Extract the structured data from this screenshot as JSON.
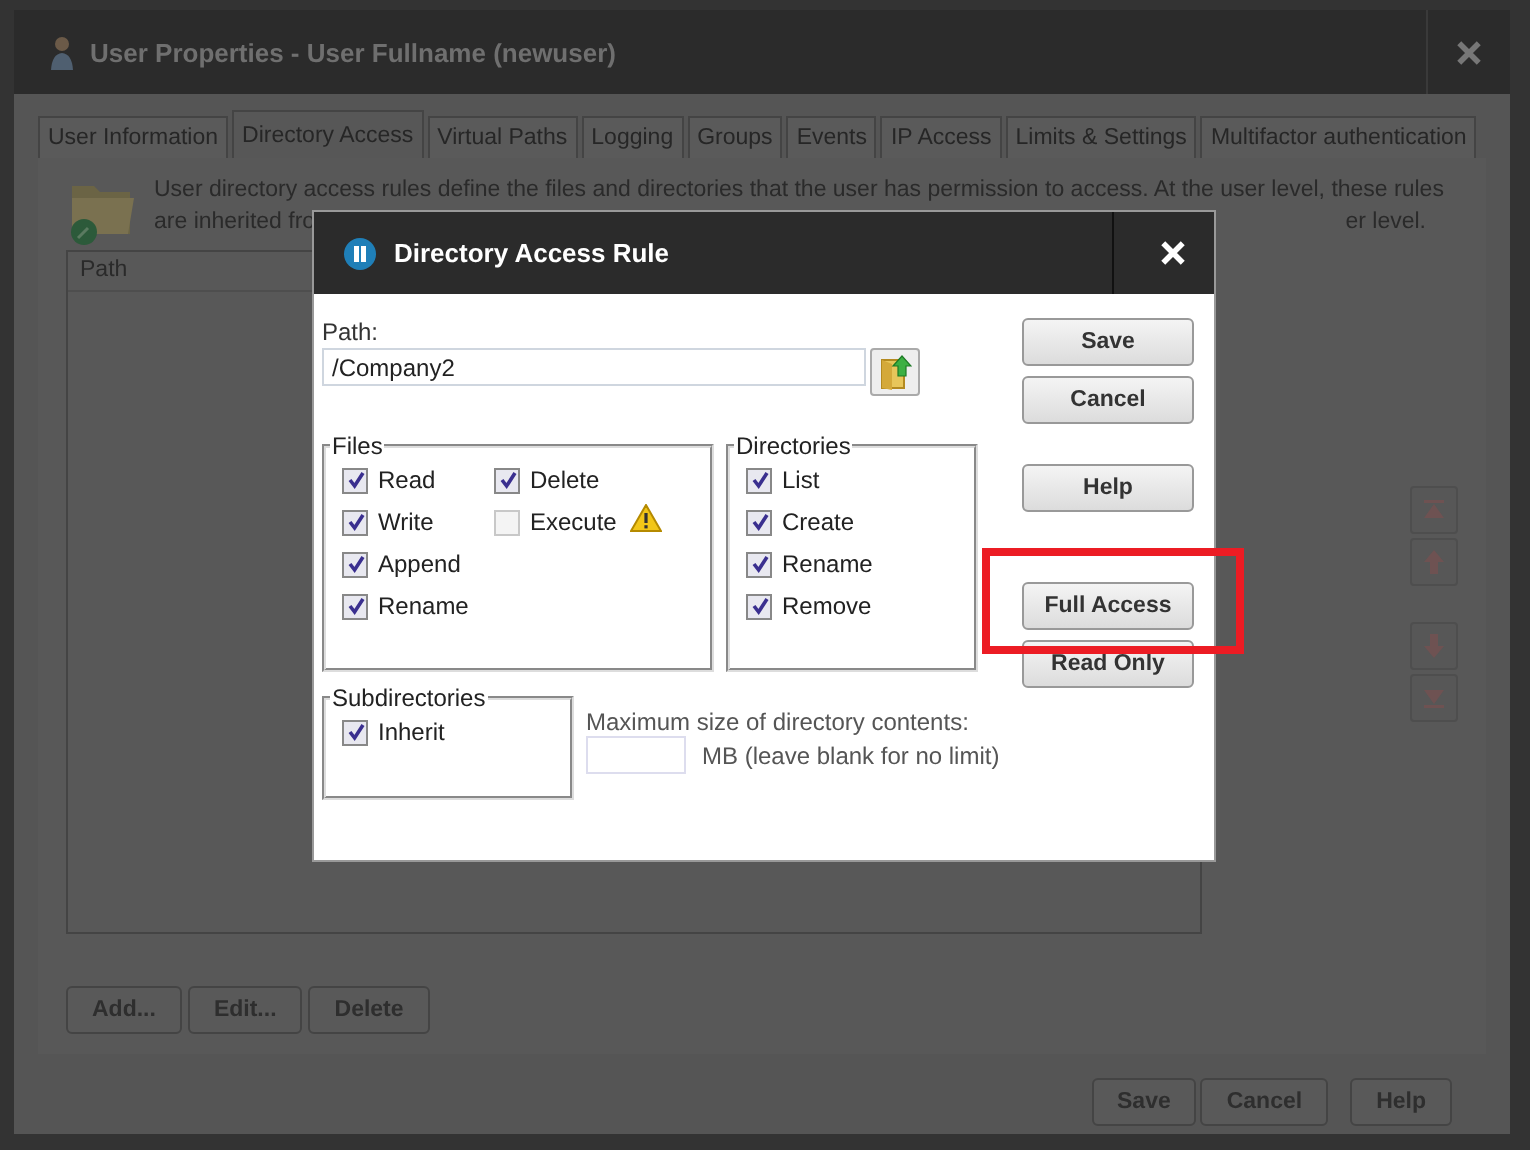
{
  "window": {
    "title": "User Properties - User Fullname (newuser)"
  },
  "tabs": [
    {
      "label": "User Information",
      "selected": false
    },
    {
      "label": "Directory Access",
      "selected": true
    },
    {
      "label": "Virtual Paths",
      "selected": false
    },
    {
      "label": "Logging",
      "selected": false
    },
    {
      "label": "Groups",
      "selected": false
    },
    {
      "label": "Events",
      "selected": false
    },
    {
      "label": "IP Access",
      "selected": false
    },
    {
      "label": "Limits & Settings",
      "selected": false
    },
    {
      "label": "Multifactor authentication",
      "selected": false
    }
  ],
  "description": {
    "line_1": "User directory access rules define the files and directories that the user has permission to access. At the user level, these rules",
    "line_2_start": "are inherited fro",
    "line_2_end": "er level."
  },
  "table": {
    "columns": [
      "Path"
    ]
  },
  "list_buttons": [
    "Add...",
    "Edit...",
    "Delete"
  ],
  "footer_buttons": [
    "Save",
    "Cancel",
    "Help"
  ],
  "dialog": {
    "title": "Directory Access Rule",
    "path_label": "Path:",
    "path_value": "/Company2",
    "files": {
      "legend": "Files",
      "columns": [
        [
          {
            "label": "Read",
            "checked": true
          },
          {
            "label": "Write",
            "checked": true
          },
          {
            "label": "Append",
            "checked": true
          },
          {
            "label": "Rename",
            "checked": true
          }
        ],
        [
          {
            "label": "Delete",
            "checked": true
          },
          {
            "label": "Execute",
            "checked": false,
            "warning": true
          }
        ]
      ]
    },
    "directories": {
      "legend": "Directories",
      "options": [
        {
          "label": "List",
          "checked": true
        },
        {
          "label": "Create",
          "checked": true
        },
        {
          "label": "Rename",
          "checked": true
        },
        {
          "label": "Remove",
          "checked": true
        }
      ]
    },
    "subdirectories": {
      "legend": "Subdirectories",
      "options": [
        {
          "label": "Inherit",
          "checked": true
        }
      ]
    },
    "max_size": {
      "label": "Maximum size of directory contents:",
      "unit": "MB (leave blank for no limit)"
    },
    "button_groups": [
      [
        "Save",
        "Cancel"
      ],
      [
        "Help"
      ],
      [
        "Full Access",
        "Read Only"
      ]
    ]
  }
}
